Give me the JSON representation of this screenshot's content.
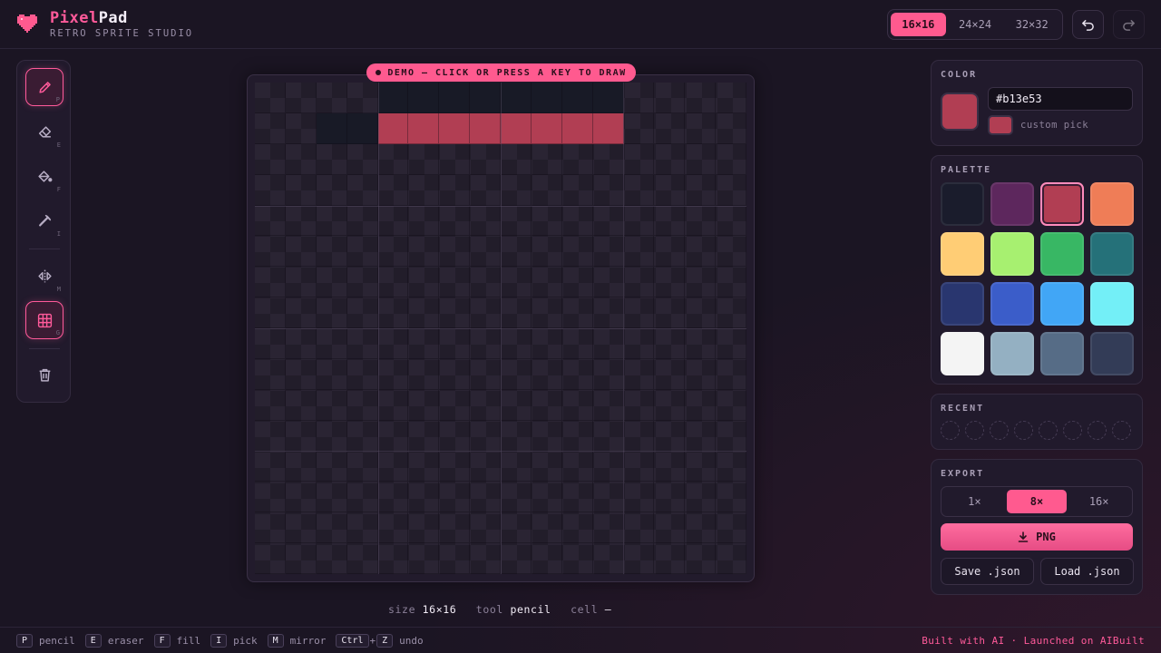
{
  "header": {
    "brand_part1": "Pixel",
    "brand_part2": "Pad",
    "tagline": "RETRO SPRITE STUDIO",
    "sizes": [
      {
        "label": "16×16",
        "active": true
      },
      {
        "label": "24×24",
        "active": false
      },
      {
        "label": "32×32",
        "active": false
      }
    ],
    "undo_icon": "undo-icon",
    "redo_icon": "redo-icon",
    "redo_enabled": false
  },
  "tools": [
    {
      "name": "pencil",
      "key": "P",
      "icon": "pencil-icon",
      "active": true
    },
    {
      "name": "eraser",
      "key": "E",
      "icon": "eraser-icon",
      "active": false
    },
    {
      "name": "fill",
      "key": "F",
      "icon": "paint-bucket-icon",
      "active": false
    },
    {
      "name": "pick",
      "key": "I",
      "icon": "eyedropper-icon",
      "active": false
    },
    {
      "name": "mirror",
      "key": "M",
      "icon": "mirror-icon",
      "active": false
    },
    {
      "name": "grid",
      "key": "G",
      "icon": "grid-icon",
      "active": true
    },
    {
      "name": "clear",
      "key": "",
      "icon": "trash-icon",
      "active": false
    }
  ],
  "canvas": {
    "demo_badge": "DEMO — CLICK OR PRESS A KEY TO DRAW",
    "grid_size": 16,
    "painted": [
      {
        "row": 0,
        "col": 4,
        "color": "#181a26"
      },
      {
        "row": 0,
        "col": 5,
        "color": "#181a26"
      },
      {
        "row": 0,
        "col": 6,
        "color": "#181a26"
      },
      {
        "row": 0,
        "col": 7,
        "color": "#181a26"
      },
      {
        "row": 0,
        "col": 8,
        "color": "#181a26"
      },
      {
        "row": 0,
        "col": 9,
        "color": "#181a26"
      },
      {
        "row": 0,
        "col": 10,
        "color": "#181a26"
      },
      {
        "row": 0,
        "col": 11,
        "color": "#181a26"
      },
      {
        "row": 1,
        "col": 2,
        "color": "#181a26"
      },
      {
        "row": 1,
        "col": 3,
        "color": "#181a26"
      },
      {
        "row": 1,
        "col": 4,
        "color": "#b13e53"
      },
      {
        "row": 1,
        "col": 5,
        "color": "#b13e53"
      },
      {
        "row": 1,
        "col": 6,
        "color": "#b13e53"
      },
      {
        "row": 1,
        "col": 7,
        "color": "#b13e53"
      },
      {
        "row": 1,
        "col": 8,
        "color": "#b13e53"
      },
      {
        "row": 1,
        "col": 9,
        "color": "#b13e53"
      },
      {
        "row": 1,
        "col": 10,
        "color": "#b13e53"
      },
      {
        "row": 1,
        "col": 11,
        "color": "#b13e53"
      }
    ]
  },
  "status": {
    "size_label": "size",
    "size_value": "16×16",
    "tool_label": "tool",
    "tool_value": "pencil",
    "cell_label": "cell",
    "cell_value": "—"
  },
  "color_panel": {
    "title": "COLOR",
    "hex": "#b13e53",
    "current_color": "#b13e53",
    "custom_pick_label": "custom pick"
  },
  "palette": {
    "title": "PALETTE",
    "colors": [
      "#1a1c2c",
      "#5d275d",
      "#b13e53",
      "#ef7d57",
      "#ffcd75",
      "#a7f070",
      "#38b764",
      "#257179",
      "#29366f",
      "#3b5dc9",
      "#41a6f6",
      "#73eff7",
      "#f4f4f4",
      "#94b0c2",
      "#566c86",
      "#333c57"
    ],
    "selected_index": 2
  },
  "recent": {
    "title": "RECENT",
    "slots": 8
  },
  "export": {
    "title": "EXPORT",
    "scales": [
      {
        "label": "1×",
        "active": false
      },
      {
        "label": "8×",
        "active": true
      },
      {
        "label": "16×",
        "active": false
      }
    ],
    "png_label": "PNG",
    "save_label": "Save .json",
    "load_label": "Load .json"
  },
  "footer": {
    "shortcuts": [
      {
        "key": "P",
        "label": "pencil"
      },
      {
        "key": "E",
        "label": "eraser"
      },
      {
        "key": "F",
        "label": "fill"
      },
      {
        "key": "I",
        "label": "pick"
      },
      {
        "key": "M",
        "label": "mirror"
      }
    ],
    "undo_key1": "Ctrl",
    "undo_key2": "Z",
    "undo_label": "undo",
    "credit": "Built with AI · Launched on AIBuilt"
  },
  "accent": "#ff5a8f"
}
